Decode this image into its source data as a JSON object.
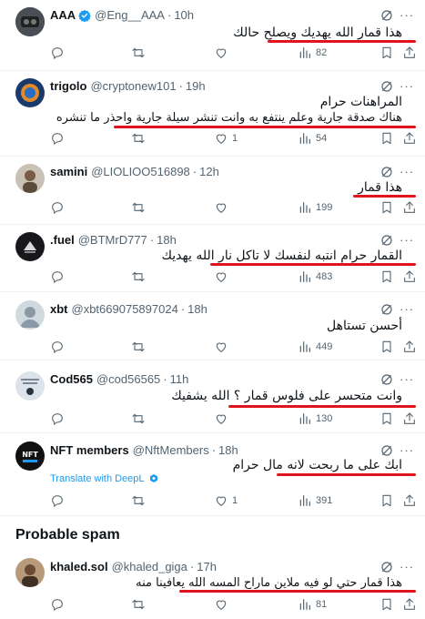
{
  "tweets": [
    {
      "name": "AAA",
      "handle": "@Eng__AAA",
      "time": "10h",
      "verified": true,
      "lines": [
        "هذا قمار الله يهديك ويصلح حالك"
      ],
      "reply": "",
      "retweet": "",
      "like": "",
      "views": "82"
    },
    {
      "name": "trigolo",
      "handle": "@cryptonew101",
      "time": "19h",
      "lines": [
        "المراهنات حرام",
        "هناك صدقة جارية وعلم ينتفع به وانت تنشر سيلة جارية واحذر ما تنشره"
      ],
      "reply": "",
      "retweet": "",
      "like": "1",
      "views": "54"
    },
    {
      "name": "samini",
      "handle": "@LIOLIOO516898",
      "time": "12h",
      "lines": [
        "هذا قمار"
      ],
      "reply": "",
      "retweet": "",
      "like": "",
      "views": "199"
    },
    {
      "name": ".fuel",
      "handle": "@BTMrD777",
      "time": "18h",
      "lines": [
        "القمار حرام  انتبه لنفسك لا تاكل نار الله يهديك"
      ],
      "reply": "",
      "retweet": "",
      "like": "",
      "views": "483"
    },
    {
      "name": "xbt",
      "handle": "@xbt669075897024",
      "time": "18h",
      "lines": [
        "أحسن تستاهل"
      ],
      "reply": "",
      "retweet": "",
      "like": "",
      "views": "449"
    },
    {
      "name": "Cod565",
      "handle": "@cod56565",
      "time": "11h",
      "lines": [
        "وانت متحسر على فلوس قمار ؟ الله يشفيك"
      ],
      "reply": "",
      "retweet": "",
      "like": "",
      "views": "130"
    },
    {
      "name": "NFT members",
      "handle": "@NftMembers",
      "time": "18h",
      "lines": [
        "ابك على ما ربحت لانه مال حرام"
      ],
      "translate": "Translate with DeepL",
      "reply": "",
      "retweet": "",
      "like": "1",
      "views": "391"
    },
    {
      "name": "khaled.sol",
      "handle": "@khaled_giga",
      "time": "17h",
      "lines": [
        "هذا قمار حتي لو فيه ملاين ماراح المسه الله يعافينا منه"
      ],
      "reply": "",
      "retweet": "",
      "like": "",
      "views": "81"
    }
  ],
  "section": {
    "title": "Probable spam"
  },
  "colors": {
    "accent": "#1d9bf0",
    "underline": "#e0141c",
    "muted": "#536471"
  },
  "icons": [
    "reply-icon",
    "retweet-icon",
    "like-icon",
    "views-icon",
    "bookmark-icon",
    "share-icon",
    "grok-icon",
    "more-icon",
    "verified-icon"
  ]
}
